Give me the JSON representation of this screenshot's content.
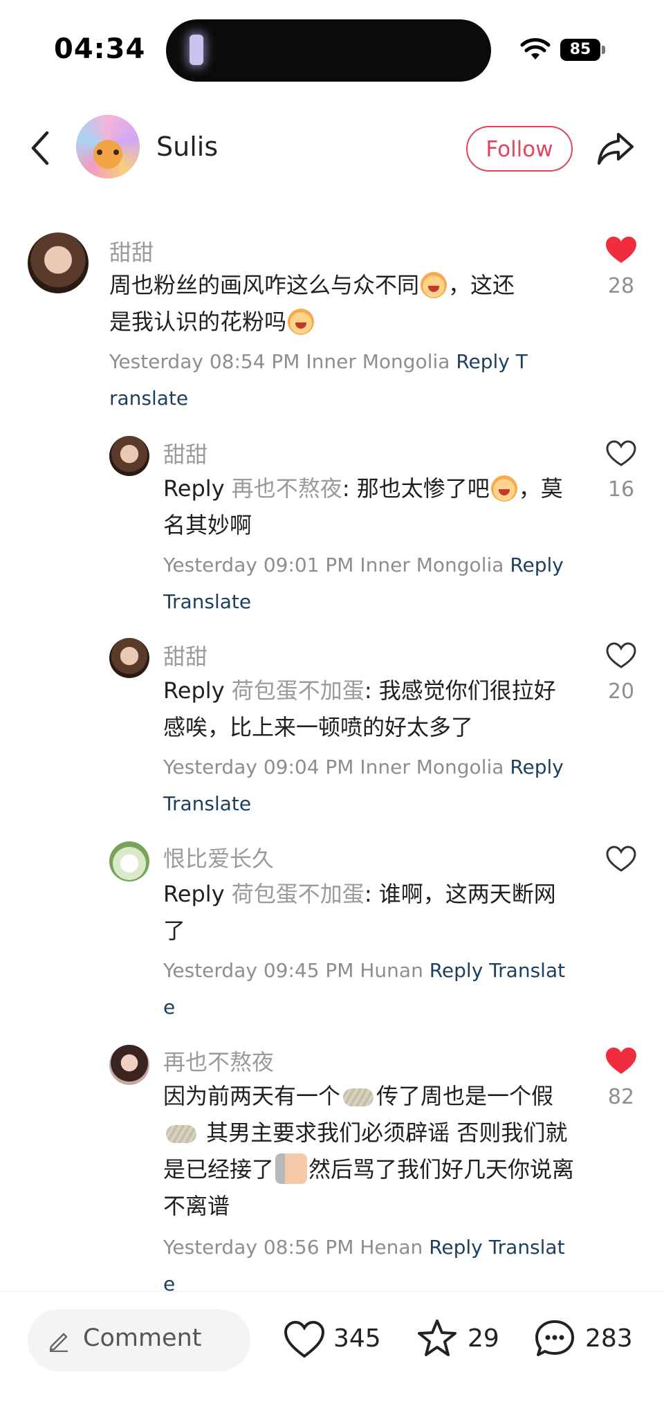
{
  "status_bar": {
    "time": "04:34",
    "battery": "85"
  },
  "header": {
    "username": "Sulis",
    "follow_label": "Follow"
  },
  "comments": [
    {
      "nick": "甜甜",
      "text_parts": [
        "周也粉丝的画风咋这么与众不同",
        "，这还是我认识的花粉吗"
      ],
      "meta": "Yesterday 08:54 PM Inner Mongolia",
      "reply_label": "Reply",
      "translate_label": "Translate",
      "likes": "28",
      "liked": true
    },
    {
      "nick": "甜甜",
      "reply_prefix": "Reply",
      "reply_to": "再也不熬夜",
      "text_parts": [
        ": 那也太惨了吧",
        "，莫名其妙啊"
      ],
      "meta": "Yesterday 09:01 PM Inner Mongolia",
      "reply_label": "Reply",
      "translate_label": "Translate",
      "likes": "16",
      "liked": false
    },
    {
      "nick": "甜甜",
      "reply_prefix": "Reply",
      "reply_to": "荷包蛋不加蛋",
      "text": ": 我感觉你们很拉好感唉，比上来一顿喷的好太多了",
      "meta": "Yesterday 09:04 PM Inner Mongolia",
      "reply_label": "Reply",
      "translate_label": "Translate",
      "likes": "20",
      "liked": false
    },
    {
      "nick": "恨比爱长久",
      "reply_prefix": "Reply",
      "reply_to": "荷包蛋不加蛋",
      "text": ": 谁啊，这两天断网了",
      "meta": "Yesterday 09:45 PM Hunan",
      "reply_label": "Reply",
      "translate_label": "Translate",
      "likes": "",
      "liked": false
    },
    {
      "nick": "再也不熬夜",
      "text_parts": [
        "因为前两天有一个",
        "传了周也是一个假",
        " 其男主要求我们必须辟谣 否则我们就是已经接了",
        "然后骂了我们好几天你说离不离谱"
      ],
      "meta": "Yesterday 08:56 PM Henan",
      "reply_label": "Reply",
      "translate_label": "Translate",
      "likes": "82",
      "liked": true
    }
  ],
  "bottom_bar": {
    "comment_placeholder": "Comment",
    "likes": "345",
    "favorites": "29",
    "comments": "283"
  },
  "colors": {
    "accent": "#e0455a",
    "link": "#1c3f5f",
    "muted": "#8e8e8e"
  }
}
